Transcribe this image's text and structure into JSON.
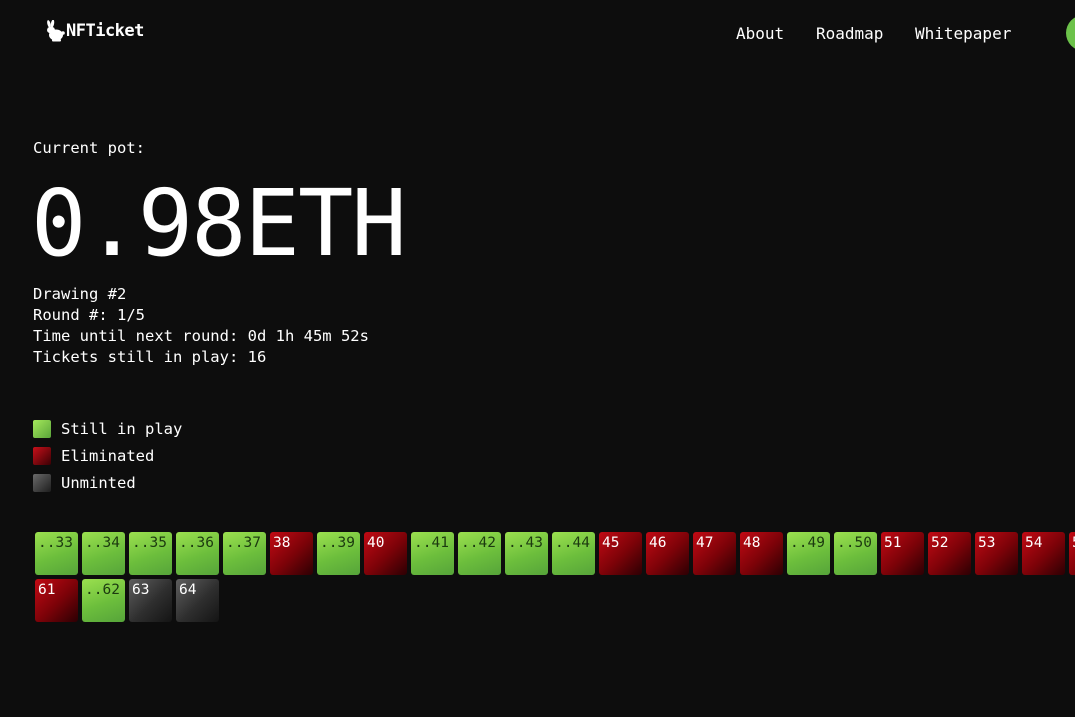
{
  "nav": {
    "logo_text": "NFTicket",
    "links": [
      "About",
      "Roadmap",
      "Whitepaper"
    ]
  },
  "pot": {
    "label": "Current pot:",
    "value": "0.98ETH"
  },
  "info": {
    "drawing": "Drawing #2",
    "round": "Round #: 1/5",
    "time": "Time until next round: 0d 1h 45m 52s",
    "tickets": "Tickets still in play: 16"
  },
  "legend": {
    "in_play": "Still in play",
    "eliminated": "Eliminated",
    "unminted": "Unminted"
  },
  "colors": {
    "in_play": "#6cbe3c",
    "eliminated": "#a00610",
    "unminted": "#3a3a3a",
    "background": "#0d0d0d"
  },
  "tickets": [
    {
      "label": "..33",
      "status": "in_play"
    },
    {
      "label": "..34",
      "status": "in_play"
    },
    {
      "label": "..35",
      "status": "in_play"
    },
    {
      "label": "..36",
      "status": "in_play"
    },
    {
      "label": "..37",
      "status": "in_play"
    },
    {
      "label": "38",
      "status": "eliminated"
    },
    {
      "label": "..39",
      "status": "in_play"
    },
    {
      "label": "40",
      "status": "eliminated"
    },
    {
      "label": "..41",
      "status": "in_play"
    },
    {
      "label": "..42",
      "status": "in_play"
    },
    {
      "label": "..43",
      "status": "in_play"
    },
    {
      "label": "..44",
      "status": "in_play"
    },
    {
      "label": "45",
      "status": "eliminated"
    },
    {
      "label": "46",
      "status": "eliminated"
    },
    {
      "label": "47",
      "status": "eliminated"
    },
    {
      "label": "48",
      "status": "eliminated"
    },
    {
      "label": "..49",
      "status": "in_play"
    },
    {
      "label": "..50",
      "status": "in_play"
    },
    {
      "label": "51",
      "status": "eliminated"
    },
    {
      "label": "52",
      "status": "eliminated"
    },
    {
      "label": "53",
      "status": "eliminated"
    },
    {
      "label": "54",
      "status": "eliminated"
    },
    {
      "label": "5",
      "status": "eliminated"
    },
    {
      "label": "61",
      "status": "eliminated"
    },
    {
      "label": "..62",
      "status": "in_play"
    },
    {
      "label": "63",
      "status": "unminted"
    },
    {
      "label": "64",
      "status": "unminted"
    }
  ]
}
